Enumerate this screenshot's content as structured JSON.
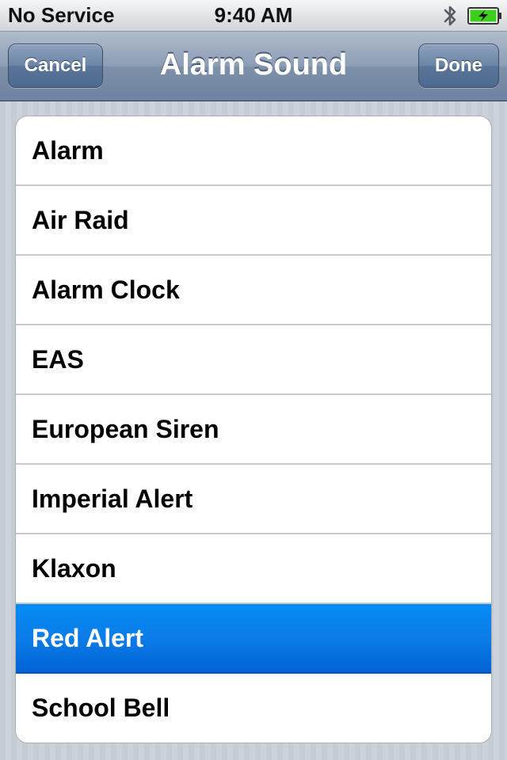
{
  "status_bar": {
    "carrier": "No Service",
    "time": "9:40 AM",
    "bluetooth_icon": "bluetooth-icon",
    "battery_icon": "battery-charging-icon",
    "battery_color": "#3ecf1c"
  },
  "nav": {
    "title": "Alarm Sound",
    "cancel_label": "Cancel",
    "done_label": "Done"
  },
  "sounds": {
    "items": [
      {
        "label": "Alarm",
        "selected": false
      },
      {
        "label": "Air Raid",
        "selected": false
      },
      {
        "label": "Alarm Clock",
        "selected": false
      },
      {
        "label": "EAS",
        "selected": false
      },
      {
        "label": "European Siren",
        "selected": false
      },
      {
        "label": "Imperial Alert",
        "selected": false
      },
      {
        "label": "Klaxon",
        "selected": false
      },
      {
        "label": "Red Alert",
        "selected": true
      },
      {
        "label": "School Bell",
        "selected": false
      }
    ],
    "selected_color": "#0a74e6"
  }
}
